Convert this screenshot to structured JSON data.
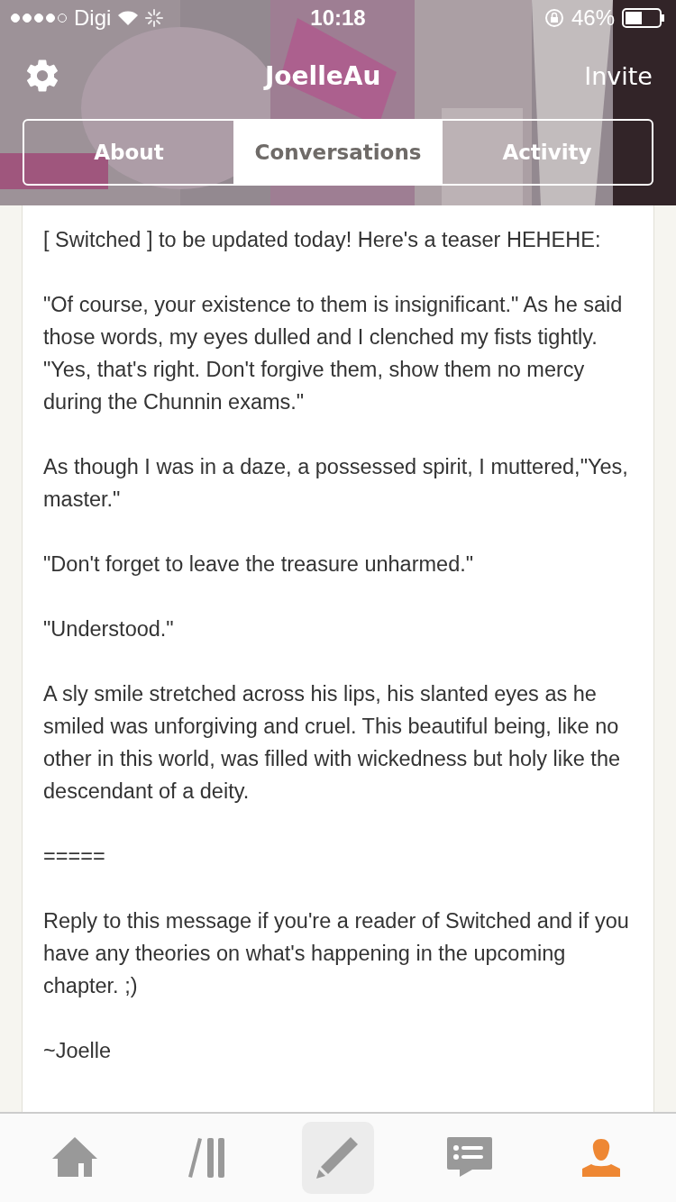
{
  "status_bar": {
    "carrier": "Digi",
    "time": "10:18",
    "battery": "46%"
  },
  "header": {
    "title": "JoelleAu",
    "invite": "Invite"
  },
  "tabs": [
    {
      "label": "About",
      "selected": false
    },
    {
      "label": "Conversations",
      "selected": true
    },
    {
      "label": "Activity",
      "selected": false
    }
  ],
  "message": {
    "paragraphs": [
      "[ Switched ] to be updated today! Here's a teaser HEHEHE:",
      "\"Of course, your existence to them is insignificant.\" As he said those words, my eyes dulled and I clenched my fists tightly. \"Yes, that's right. Don't forgive them, show them no mercy during the Chunnin exams.\"",
      "As though I was in a daze, a possessed spirit, I muttered,\"Yes, master.\"",
      "\"Don't forget to leave the treasure unharmed.\"",
      "\"Understood.\"",
      "A sly smile stretched across his lips, his slanted eyes as he smiled was unforgiving and cruel. This beautiful being, like no other in this world, was filled with wickedness but holy like the descendant of a deity.",
      "=====",
      "Reply to this message if you're a reader of Switched and if you have any theories on what's happening in the upcoming chapter. ;)",
      "~Joelle"
    ]
  },
  "bottom_nav": [
    {
      "kind": "home",
      "selected": false
    },
    {
      "kind": "library",
      "selected": false
    },
    {
      "kind": "write",
      "selected": false
    },
    {
      "kind": "messages",
      "selected": false
    },
    {
      "kind": "profile",
      "selected": true
    }
  ]
}
